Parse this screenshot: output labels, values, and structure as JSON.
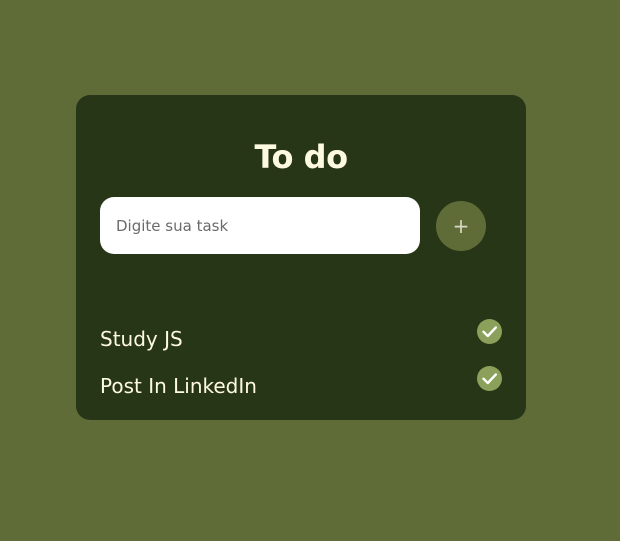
{
  "card": {
    "title": "To do",
    "input": {
      "placeholder": "Digite sua task",
      "value": ""
    },
    "add_button_label": "+"
  },
  "tasks": [
    {
      "label": "Study JS",
      "done": true
    },
    {
      "label": "Post In LinkedIn",
      "done": true
    }
  ],
  "colors": {
    "page_background": "#606c38",
    "card_background": "#283618",
    "text_light": "#fefae0",
    "check_fill": "#8ba05a"
  },
  "icons": {
    "check": "check-circle-icon",
    "add": "plus-icon"
  }
}
